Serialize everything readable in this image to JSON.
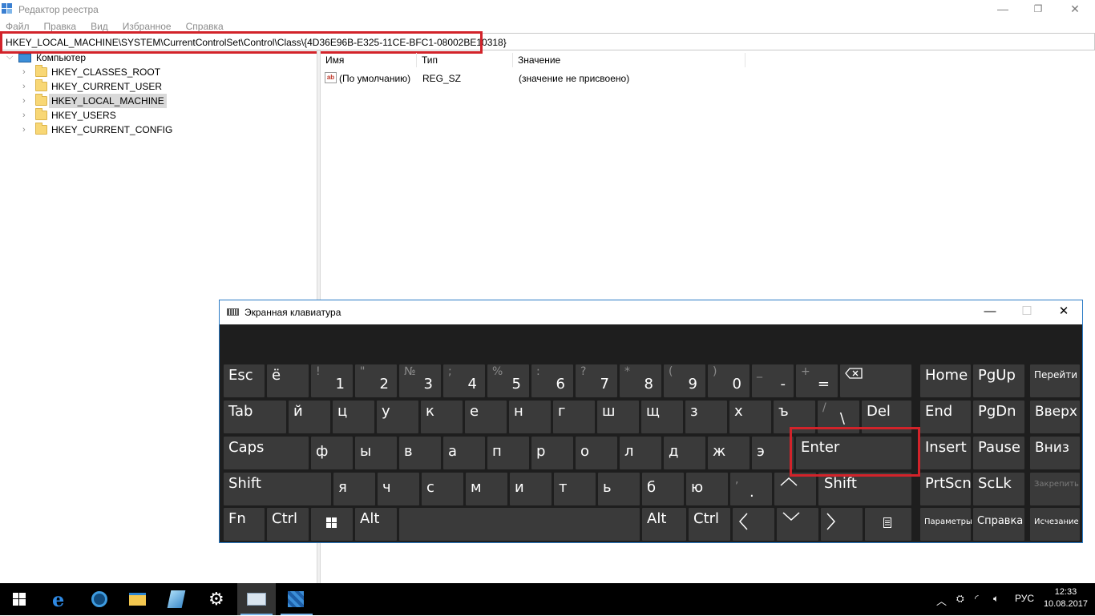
{
  "regedit": {
    "title": "Редактор реестра",
    "window_controls": [
      "—",
      "❐",
      "✕"
    ],
    "menu": [
      "Файл",
      "Правка",
      "Вид",
      "Избранное",
      "Справка"
    ],
    "address": "HKEY_LOCAL_MACHINE\\SYSTEM\\CurrentControlSet\\Control\\Class\\{4D36E96B-E325-11CE-BFC1-08002BE10318}",
    "tree": {
      "root": "Компьютер",
      "items": [
        {
          "label": "HKEY_CLASSES_ROOT",
          "selected": false
        },
        {
          "label": "HKEY_CURRENT_USER",
          "selected": false
        },
        {
          "label": "HKEY_LOCAL_MACHINE",
          "selected": true
        },
        {
          "label": "HKEY_USERS",
          "selected": false
        },
        {
          "label": "HKEY_CURRENT_CONFIG",
          "selected": false
        }
      ]
    },
    "columns": [
      "Имя",
      "Тип",
      "Значение"
    ],
    "rows": [
      {
        "name": "(По умолчанию)",
        "type": "REG_SZ",
        "value": "(значение не присвоено)",
        "icon": "ab"
      }
    ]
  },
  "osk": {
    "title": "Экранная клавиатура",
    "controls": [
      "—",
      "☐",
      "✕"
    ],
    "keys": {
      "esc": "Esc",
      "yo": "ё",
      "n1": {
        "main": "1",
        "shift": "!"
      },
      "n2": {
        "main": "2",
        "shift": "\""
      },
      "n3": {
        "main": "3",
        "shift": "№"
      },
      "n4": {
        "main": "4",
        "shift": ";"
      },
      "n5": {
        "main": "5",
        "shift": "%"
      },
      "n6": {
        "main": "6",
        "shift": ":"
      },
      "n7": {
        "main": "7",
        "shift": "?"
      },
      "n8": {
        "main": "8",
        "shift": "*"
      },
      "n9": {
        "main": "9",
        "shift": "("
      },
      "n0": {
        "main": "0",
        "shift": ")"
      },
      "minus": {
        "main": "-",
        "shift": "_"
      },
      "equals": {
        "main": "=",
        "shift": "+"
      },
      "home": "Home",
      "pgup": "PgUp",
      "goto": "Перейти",
      "tab": "Tab",
      "r2": [
        "й",
        "ц",
        "у",
        "к",
        "е",
        "н",
        "г",
        "ш",
        "щ",
        "з",
        "х",
        "ъ"
      ],
      "slash": {
        "main": "\\",
        "shift": "/"
      },
      "del": "Del",
      "end": "End",
      "pgdn": "PgDn",
      "up_word": "Вверх",
      "caps": "Caps",
      "r3": [
        "ф",
        "ы",
        "в",
        "а",
        "п",
        "р",
        "о",
        "л",
        "д",
        "ж",
        "э"
      ],
      "enter": "Enter",
      "insert": "Insert",
      "pause": "Pause",
      "down_word": "Вниз",
      "shift": "Shift",
      "r4": [
        "я",
        "ч",
        "с",
        "м",
        "и",
        "т",
        "ь",
        "б",
        "ю"
      ],
      "period": {
        "main": ".",
        "shift": ","
      },
      "shift_right": "Shift",
      "prtscn": "PrtScn",
      "sclk": "ScLk",
      "scroll_lock": "Закрепить",
      "fn": "Fn",
      "ctrl": "Ctrl",
      "alt": "Alt",
      "alt_right": "Alt",
      "ctrl_right": "Ctrl",
      "params": "Параметры",
      "help": "Справка",
      "fade": "Исчезание"
    }
  },
  "taskbar": {
    "lang": "РУС",
    "time": "12:33",
    "date": "10.08.2017",
    "colors": {
      "accent": "#2b7cc6",
      "highlight": "#d2232a"
    }
  }
}
